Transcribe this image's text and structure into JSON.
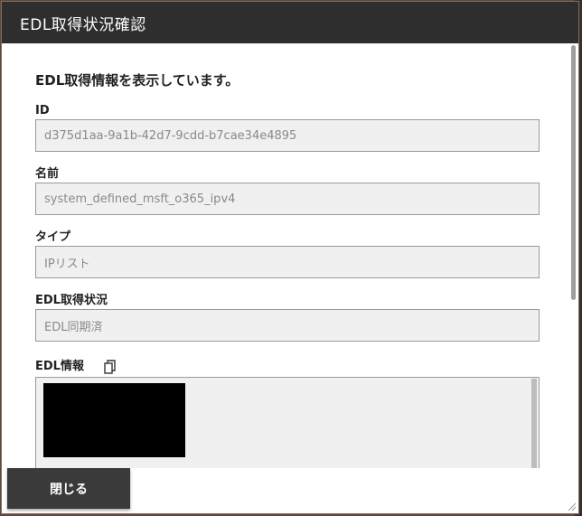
{
  "dialog": {
    "title": "EDL取得状況確認",
    "intro": "EDL取得情報を表示しています。",
    "close_label": "閉じる"
  },
  "fields": {
    "id": {
      "label": "ID",
      "value": "d375d1aa-9a1b-42d7-9cdd-b7cae34e4895"
    },
    "name": {
      "label": "名前",
      "value": "system_defined_msft_o365_ipv4"
    },
    "type": {
      "label": "タイプ",
      "value": "IPリスト"
    },
    "status": {
      "label": "EDL取得状況",
      "value": "EDL同期済"
    },
    "edl": {
      "label": "EDL情報"
    }
  },
  "icons": {
    "copy": "copy-icon"
  },
  "colors": {
    "header_bg": "#2e2e2e",
    "button_bg": "#3a3a3a",
    "field_bg": "#f0f0f0",
    "redaction": "#000000"
  }
}
